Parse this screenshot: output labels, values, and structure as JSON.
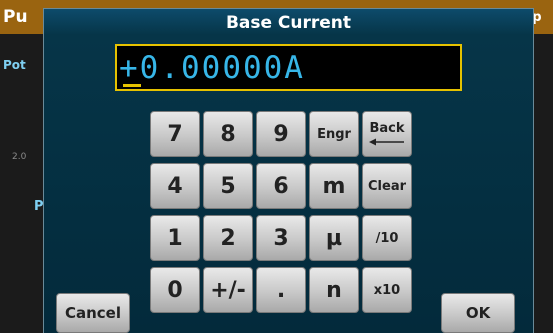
{
  "background": {
    "title_left": "Pu",
    "title_right": "pp",
    "label_1": "Pot",
    "axis_value": "2.0",
    "label_2": "P",
    "colors": {
      "header": "#9a6410",
      "accent_text": "#7fd0f2"
    }
  },
  "dialog": {
    "title": "Base Current",
    "display_value": "+0.00000A",
    "colors": {
      "display_text": "#37b6e8",
      "display_border": "#e6c200"
    }
  },
  "keypad": {
    "row1": [
      "7",
      "8",
      "9",
      "Engr",
      "Back"
    ],
    "row2": [
      "4",
      "5",
      "6",
      "m",
      "Clear"
    ],
    "row3": [
      "1",
      "2",
      "3",
      "µ",
      "/10"
    ],
    "row4": [
      "0",
      "+/-",
      ".",
      "n",
      "x10"
    ],
    "back_icon": "left-arrow-icon"
  },
  "buttons": {
    "cancel": "Cancel",
    "ok": "OK"
  }
}
